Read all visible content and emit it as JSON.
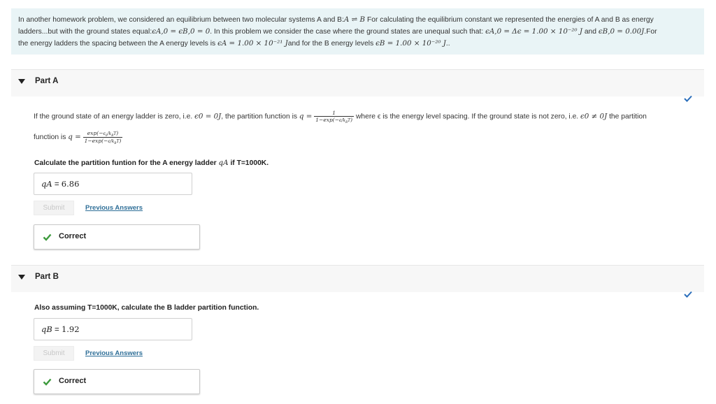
{
  "intro": {
    "s1": "In another  homework problem, we considered an equilibrium between two molecular systems A and B:",
    "eq": "A ⇌ B",
    "s2": " For calculating the equilibrium constant we represented the energies of A and B as energy",
    "s3": "ladders...but with the ground states equal:",
    "ground_equal": "ϵA,0 = ϵB,0 = 0",
    "s4": ". In this problem we consider the case where the ground states are unequal such that: ",
    "e_a0": "ϵA,0 = Δϵ = 1.00 × 10⁻²⁰ J",
    "s5": " and ",
    "e_b0": "ϵB,0 = 0.00J",
    "s6": ".For",
    "s7": "the energy ladders the spacing between the A energy levels is ",
    "e_a": "ϵA = 1.00 × 10⁻²¹ J",
    "s8": "and for the B energy levels ",
    "e_b": "ϵB = 1.00 × 10⁻²⁰ J",
    "s9": ".."
  },
  "partA": {
    "title": "Part A",
    "line1a": "If the ground state of an energy ladder is zero, i.e. ",
    "line1b": "ϵ0 = 0J",
    "line1c": ", the partition function is ",
    "line1d": " where ϵ is the energy level spacing. If the ground state is not zero, i.e. ",
    "line1e": "ϵ0 ≠ 0J",
    "line1f": " the partition",
    "line2": "function is ",
    "question": "Calculate the partition funtion for the A energy ladder ",
    "question_var": "qA",
    "question_end": " if T=1000K.",
    "answer_label": "qA",
    "answer_value": "6.86",
    "submit": "Submit",
    "previous": "Previous Answers",
    "result": "Correct"
  },
  "partB": {
    "title": "Part B",
    "question": "Also assuming T=1000K, calculate the B ladder partition function.",
    "answer_label": "qB",
    "answer_value": "1.92",
    "submit": "Submit",
    "previous": "Previous Answers",
    "result": "Correct"
  },
  "colors": {
    "accent_check": "#2a6ebb",
    "correct_green": "#3c9a3c",
    "intro_bg": "#e9f4f6",
    "link": "#2f6f98"
  }
}
